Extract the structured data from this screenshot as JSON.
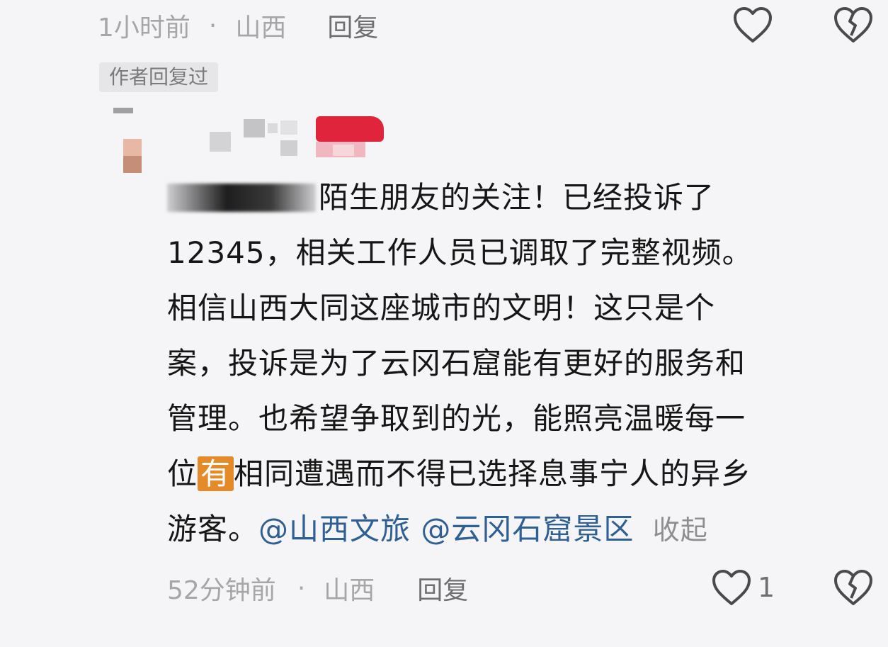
{
  "parent_comment": {
    "time": "1小时前",
    "separator": "·",
    "location": "山西",
    "reply_label": "回复",
    "like_icon": "heart-outline-icon",
    "dislike_icon": "broken-heart-icon"
  },
  "author_tag": "作者回复过",
  "reply_comment": {
    "obscured_prefix": "谢谢每一",
    "line1_text": "陌生朋友的关注！已经投诉了",
    "line2": "12345，相关工作人员已调取了完整视频。",
    "line3": "相信山西大同这座城市的文明！这只是个",
    "line4": "案，投诉是为了云冈石窟能有更好的服务和",
    "line5": "管理。也希望争取到的光，能照亮温暖每一",
    "line6_pre": "位",
    "line6_highlight": "有",
    "line6_post": "相同遭遇而不得已选择息事宁人的异乡",
    "line7_text": "游客。",
    "mentions": [
      "@山西文旅",
      "@云冈石窟景区"
    ],
    "collapse_label": "收起",
    "time": "52分钟前",
    "separator": "·",
    "location": "山西",
    "reply_label": "回复",
    "like_count": "1",
    "like_icon": "heart-outline-icon",
    "dislike_icon": "broken-heart-icon"
  },
  "colors": {
    "background": "#f5f4f6",
    "meta_gray": "#a6a6a8",
    "mention_blue": "#2f5f93",
    "highlight_orange": "#e58a28",
    "avatar_red": "#e0243c"
  }
}
